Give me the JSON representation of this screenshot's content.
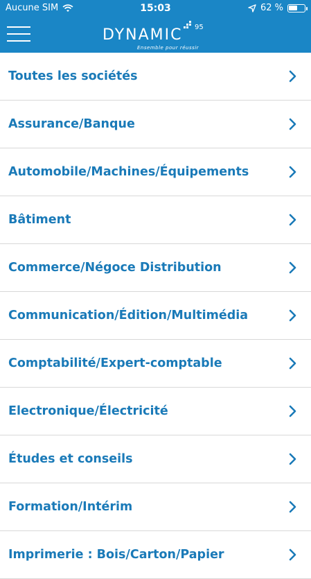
{
  "status_bar": {
    "carrier": "Aucune SIM",
    "time": "15:03",
    "battery": "62 %",
    "battery_level": 0.62,
    "icons": [
      "wifi-icon",
      "location-arrow-icon",
      "battery-icon"
    ]
  },
  "header": {
    "menu_icon": "hamburger-menu-icon",
    "logo": {
      "word": "DYNAMIC",
      "number": "95",
      "tagline": "Ensemble pour réussir"
    },
    "background_color": "#1a86c6"
  },
  "categories": [
    {
      "label": "Toutes les sociétés"
    },
    {
      "label": "Assurance/Banque"
    },
    {
      "label": "Automobile/Machines/Équipements"
    },
    {
      "label": "Bâtiment"
    },
    {
      "label": "Commerce/Négoce Distribution"
    },
    {
      "label": "Communication/Édition/Multimédia"
    },
    {
      "label": "Comptabilité/Expert-comptable"
    },
    {
      "label": "Electronique/Électricité"
    },
    {
      "label": "Études et conseils"
    },
    {
      "label": "Formation/Intérim"
    },
    {
      "label": "Imprimerie : Bois/Carton/Papier"
    }
  ],
  "colors": {
    "accent": "#1a7ab8",
    "divider": "#d8d8d8"
  }
}
